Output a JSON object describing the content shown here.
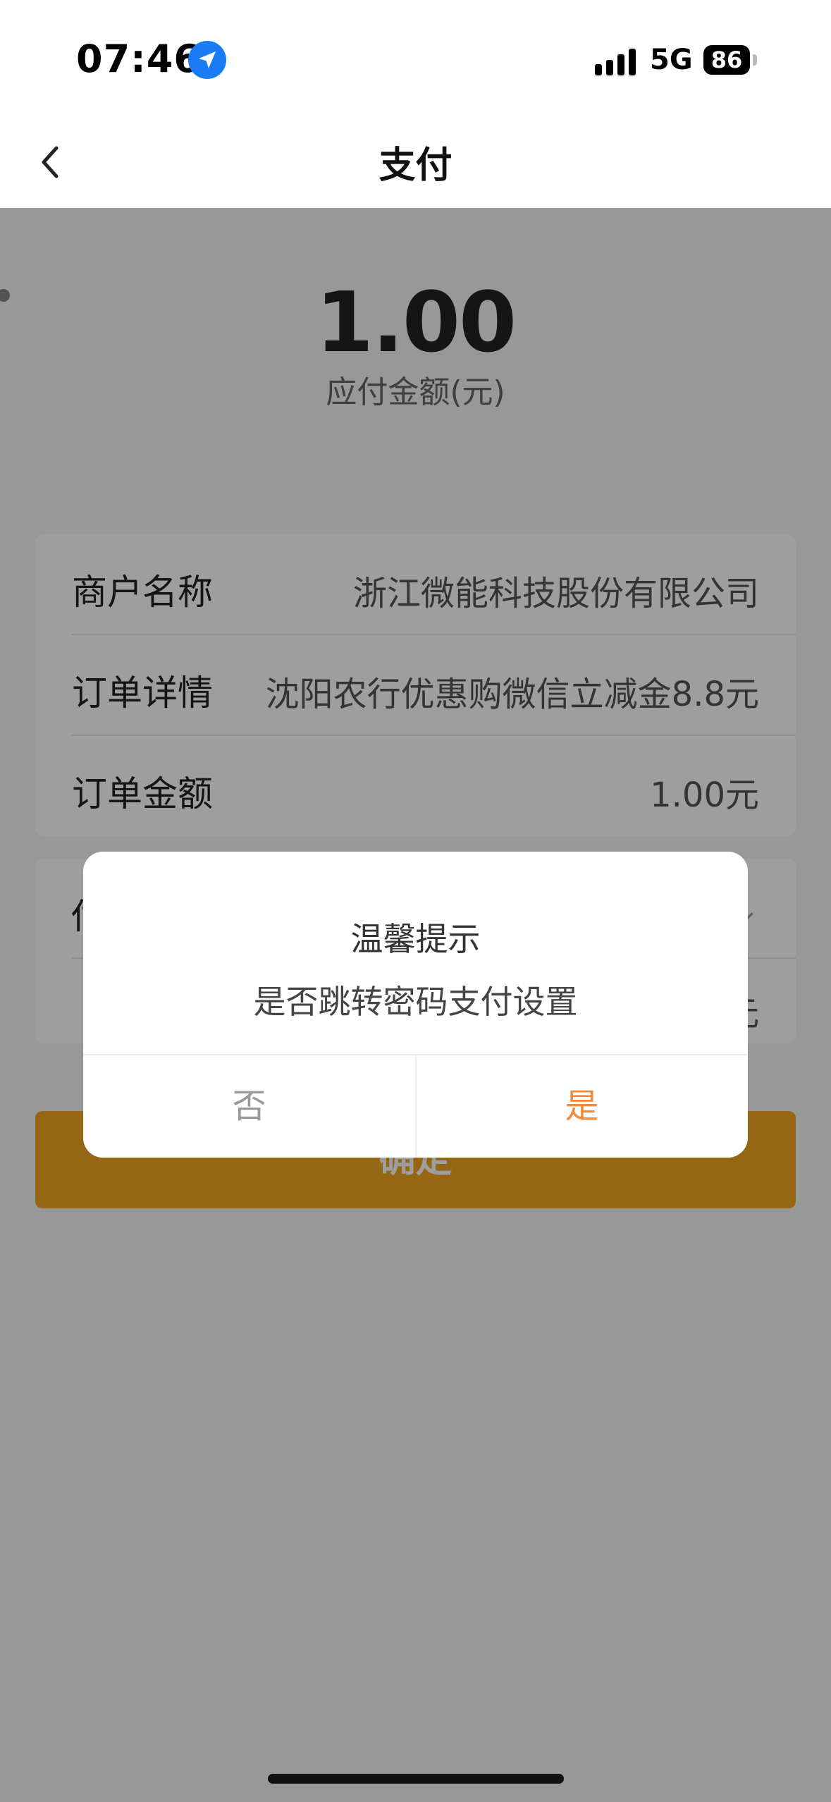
{
  "status_bar": {
    "time": "07:46",
    "network": "5G",
    "battery": "86"
  },
  "nav": {
    "title": "支付",
    "back_icon": "chevron-left-icon"
  },
  "payment": {
    "amount": "1.00",
    "amount_label": "应付金额(元)"
  },
  "order_card": {
    "rows": [
      {
        "label": "商户名称",
        "value": "浙江微能科技股份有限公司"
      },
      {
        "label": "订单详情",
        "value": "沈阳农行优惠购微信立减金8.8元"
      },
      {
        "label": "订单金额",
        "value": "1.00元"
      }
    ]
  },
  "payment_card": {
    "label_partial": "付",
    "value_partial": "元"
  },
  "confirm_button": {
    "label": "确定",
    "color": "#f0a520"
  },
  "dialog": {
    "title": "温馨提示",
    "message": "是否跳转密码支付设置",
    "no_label": "否",
    "yes_label": "是",
    "yes_color": "#f08a3c"
  }
}
